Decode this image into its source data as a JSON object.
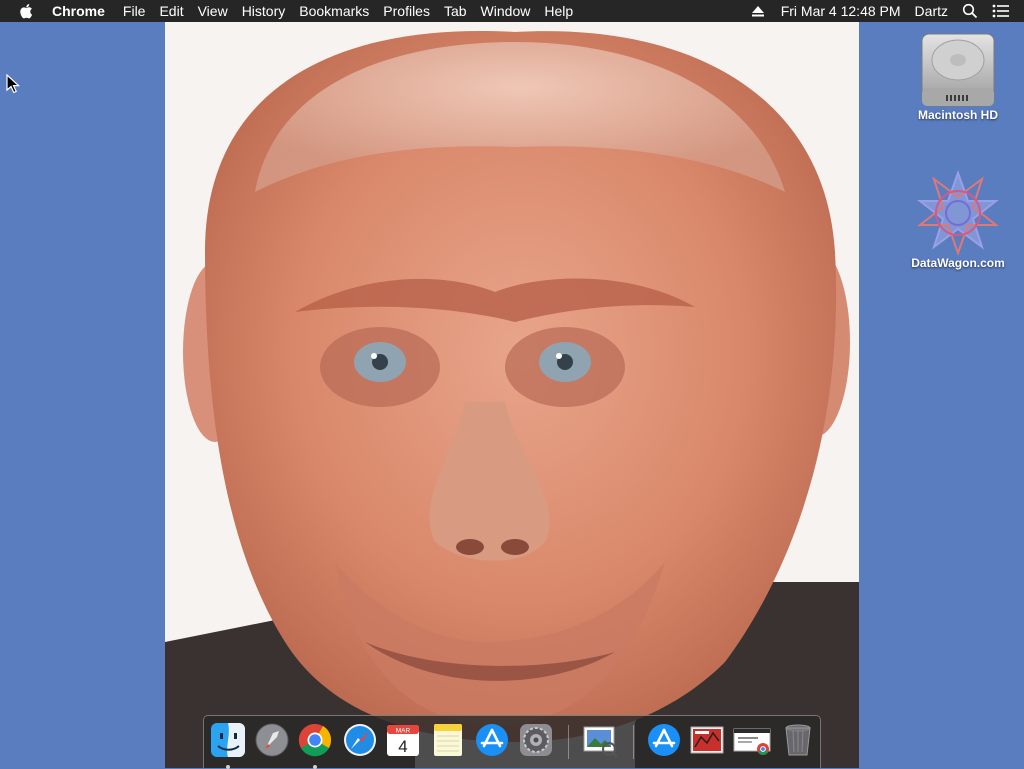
{
  "menubar": {
    "app_name": "Chrome",
    "items": [
      "File",
      "Edit",
      "View",
      "History",
      "Bookmarks",
      "Profiles",
      "Tab",
      "Window",
      "Help"
    ],
    "clock": "Fri Mar 4  12:48 PM",
    "user": "Dartz",
    "icons": [
      "apple-logo",
      "eject-icon",
      "spotlight-search-icon",
      "notification-center-icon"
    ]
  },
  "desktop": {
    "background_color": "#5a7dbf",
    "icons": [
      {
        "label": "Macintosh HD",
        "icon": "hard-drive-icon"
      },
      {
        "label": "DataWagon.com",
        "icon": "datawagon-logo-icon"
      }
    ]
  },
  "photo": {
    "subject": "edited-portrait-photo"
  },
  "dock": {
    "items": [
      {
        "name": "Finder",
        "icon": "finder-icon",
        "running": true
      },
      {
        "name": "Launchpad",
        "icon": "launchpad-icon",
        "running": false
      },
      {
        "name": "Google Chrome",
        "icon": "chrome-icon",
        "running": true
      },
      {
        "name": "Safari",
        "icon": "safari-icon",
        "running": false
      },
      {
        "name": "Calendar",
        "icon": "calendar-icon",
        "running": false,
        "month": "MAR",
        "day": "4"
      },
      {
        "name": "Notes",
        "icon": "notes-icon",
        "running": false
      },
      {
        "name": "App Store",
        "icon": "app-store-icon",
        "running": false
      },
      {
        "name": "System Preferences",
        "icon": "system-preferences-icon",
        "running": false
      },
      {
        "name": "Preview",
        "icon": "preview-icon",
        "running": false
      },
      {
        "name": "Applications",
        "icon": "applications-folder-icon",
        "running": false
      },
      {
        "name": "Downloads",
        "icon": "downloads-stack-icon",
        "running": false
      },
      {
        "name": "Chrome Document",
        "icon": "chrome-document-icon",
        "running": false
      },
      {
        "name": "Trash",
        "icon": "trash-icon",
        "running": false
      }
    ]
  },
  "colors": {
    "menubar_bg": "#262626",
    "desktop_bg": "#5a7dbf",
    "dock_bg": "#282828"
  }
}
